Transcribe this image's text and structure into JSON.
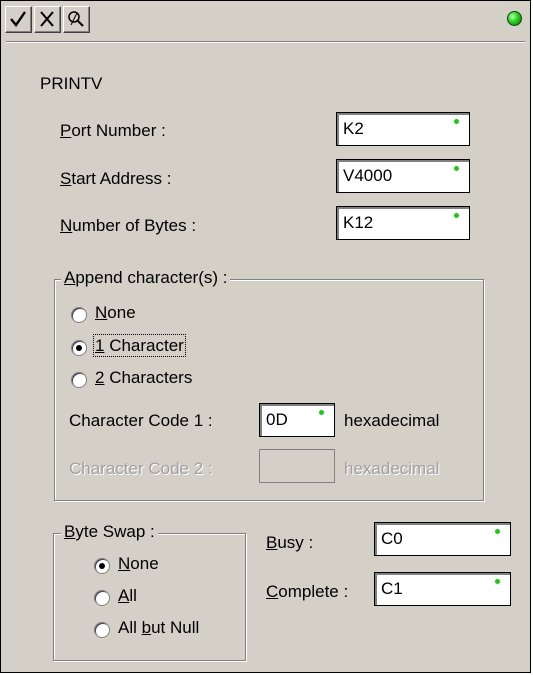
{
  "toolbar": {
    "accept_icon": "checkmark-icon",
    "cancel_icon": "x-icon",
    "help_icon": "help-icon",
    "status_color": "#24d11c"
  },
  "instruction": "PRINTV",
  "port": {
    "label_u": "P",
    "label_rest": "ort Number :",
    "value": "K2"
  },
  "start": {
    "label_u": "S",
    "label_rest": "tart Address :",
    "value": "V4000"
  },
  "bytes": {
    "label_u": "N",
    "label_rest": "umber of Bytes :",
    "value": "K12"
  },
  "append": {
    "title_u": "A",
    "title_rest": "ppend character(s) :",
    "opt_none_u": "N",
    "opt_none_rest": "one",
    "opt_one_u": "1",
    "opt_one_rest": " Character",
    "opt_two_u": "2",
    "opt_two_rest": " Characters",
    "selected": "1 Character",
    "code1_label": "Character  Code 1 :",
    "code1_value": "0D",
    "code1_unit": "hexadecimal",
    "code2_label": "Character  Code 2 :",
    "code2_value": "",
    "code2_unit": "hexadecimal"
  },
  "swap": {
    "title_u": "B",
    "title_rest": "yte Swap :",
    "opt_none_u": "N",
    "opt_none_rest": "one",
    "opt_all_u": "A",
    "opt_all_rest": "ll",
    "opt_butnull_pre": "All ",
    "opt_butnull_u": "b",
    "opt_butnull_rest": "ut Null",
    "selected": "None"
  },
  "busy": {
    "label_u": "B",
    "label_rest": "usy :",
    "value": "C0"
  },
  "complete": {
    "label_u": "C",
    "label_rest": "omplete :",
    "value": "C1"
  }
}
